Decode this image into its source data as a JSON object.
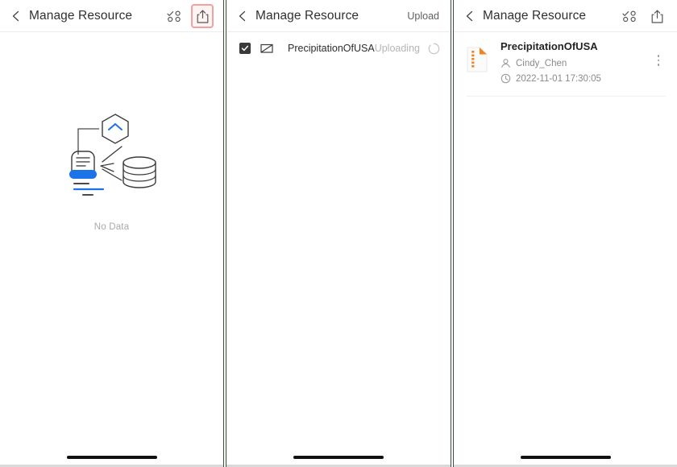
{
  "panels": [
    {
      "header": {
        "back_icon": "chevron-left-icon",
        "title": "Manage Resource",
        "select_icon": "multi-select-icon",
        "share_icon": "share-upload-icon",
        "share_highlighted": true,
        "highlight_color": "#f2a0a0"
      },
      "empty_state": {
        "illustration": "no-data-illustration",
        "label": "No Data",
        "accent_color": "#1a73e8"
      }
    },
    {
      "header": {
        "back_icon": "chevron-left-icon",
        "title": "Manage Resource",
        "action_label": "Upload"
      },
      "upload_row": {
        "checkbox_icon": "checkbox-checked-icon",
        "checked": true,
        "file_icon": "image-file-icon",
        "name": "PrecipitationOfUSA",
        "status": "Uploading",
        "spinner_icon": "loading-spinner-icon"
      }
    },
    {
      "header": {
        "back_icon": "chevron-left-icon",
        "title": "Manage Resource",
        "select_icon": "multi-select-icon",
        "share_icon": "share-upload-icon"
      },
      "resource": {
        "file_icon": "zip-archive-icon",
        "file_icon_color": "#f2821e",
        "title": "PrecipitationOfUSA",
        "owner_icon": "user-icon",
        "owner": "Cindy_Chen",
        "time_icon": "clock-icon",
        "time": "2022-11-01 17:30:05",
        "menu_icon": "kebab-menu-icon"
      }
    }
  ]
}
